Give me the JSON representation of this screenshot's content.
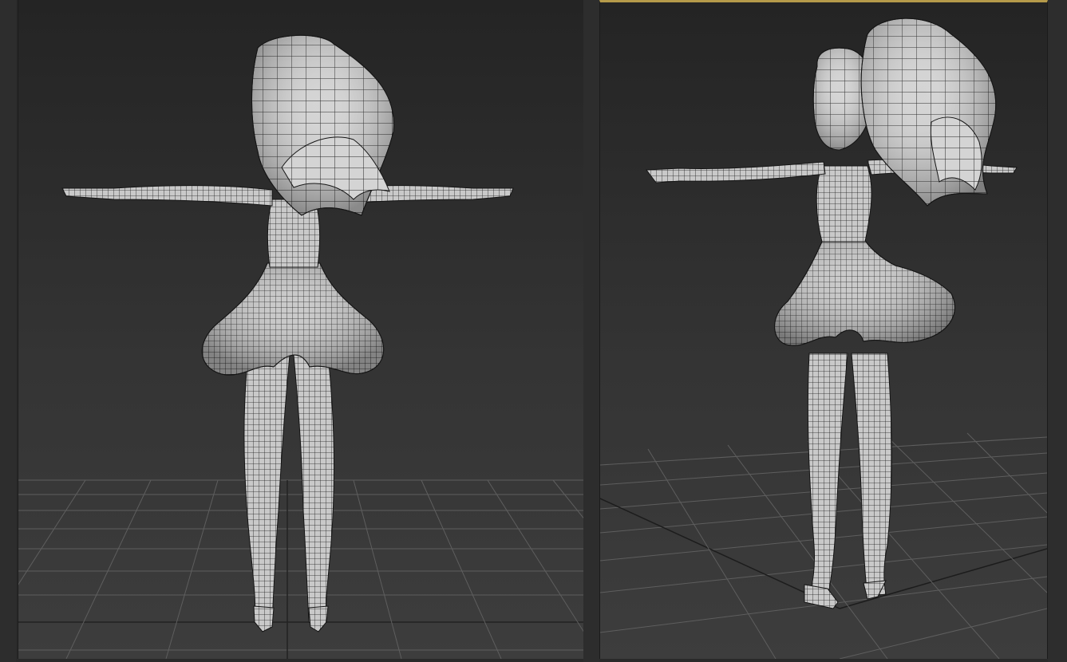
{
  "app": {
    "title": "",
    "layout": "two-viewports"
  },
  "viewports": [
    {
      "id": "left",
      "view": "front",
      "active": false,
      "shading": "wireframe-on-shaded",
      "grid": true,
      "model": "stylized-female-character-t-pose"
    },
    {
      "id": "right",
      "view": "perspective",
      "active": true,
      "shading": "wireframe-on-shaded",
      "grid": true,
      "model": "stylized-female-character-t-pose"
    }
  ],
  "colors": {
    "background": "#2a2a2a",
    "viewport_top": "#242424",
    "viewport_bottom": "#3d3d3d",
    "active_border": "#b59a4a",
    "grid_line": "#5a5a5a",
    "mesh_fill": "#c8c8c8",
    "mesh_wire": "#1a1a1a"
  }
}
